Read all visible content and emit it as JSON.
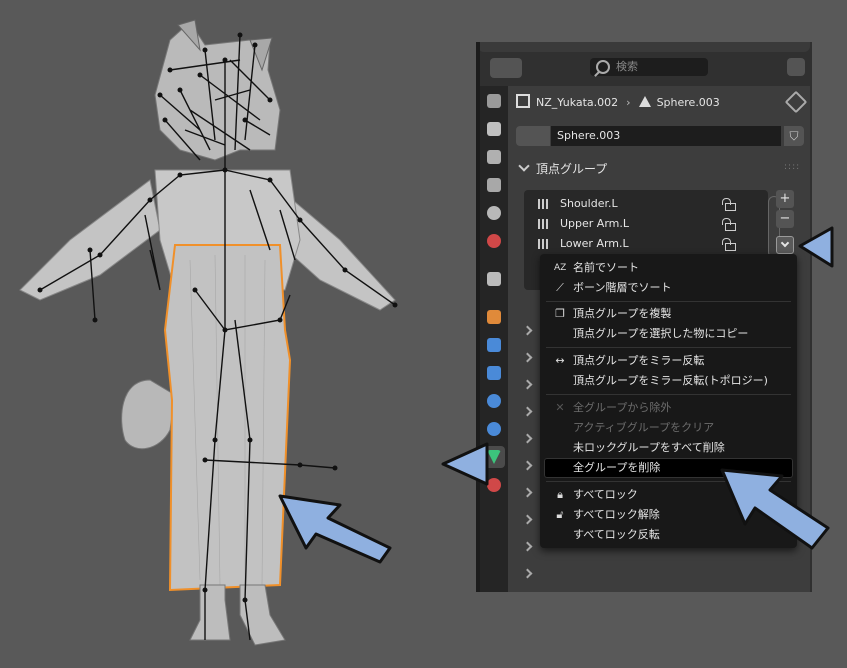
{
  "search": {
    "placeholder": "検索"
  },
  "breadcrumb": {
    "object": "NZ_Yukata.002",
    "mesh": "Sphere.003"
  },
  "datablock": {
    "name": "Sphere.003"
  },
  "section": {
    "title": "頂点グループ"
  },
  "vertex_groups": [
    {
      "name": "Shoulder.L"
    },
    {
      "name": "Upper Arm.L"
    },
    {
      "name": "Lower Arm.L"
    }
  ],
  "list_buttons": {
    "add": "+",
    "remove": "−"
  },
  "context_menu": {
    "items": [
      {
        "label": "名前でソート",
        "icon": "AZ",
        "disabled": false
      },
      {
        "label": "ボーン階層でソート",
        "icon": "bone-icon",
        "disabled": false
      },
      {
        "label": "頂点グループを複製",
        "icon": "copy-icon",
        "disabled": false
      },
      {
        "label": "頂点グループを選択した物にコピー",
        "icon": "",
        "disabled": false
      },
      {
        "label": "頂点グループをミラー反転",
        "icon": "mirror-icon",
        "disabled": false
      },
      {
        "label": "頂点グループをミラー反転(トポロジー)",
        "icon": "",
        "disabled": false
      },
      {
        "label": "全グループから除外",
        "icon": "x-icon",
        "disabled": true
      },
      {
        "label": "アクティブグループをクリア",
        "icon": "",
        "disabled": true
      },
      {
        "label": "未ロックグループをすべて削除",
        "icon": "",
        "disabled": false
      },
      {
        "label": "全グループを削除",
        "icon": "",
        "disabled": false,
        "highlighted": true
      },
      {
        "label": "すべてロック",
        "icon": "lock-icon",
        "disabled": false
      },
      {
        "label": "すべてロック解除",
        "icon": "unlock-icon",
        "disabled": false
      },
      {
        "label": "すべてロック反転",
        "icon": "",
        "disabled": false
      }
    ]
  },
  "colors": {
    "annotation_arrow": "#8fb0e0",
    "selection_outline": "#f0902a",
    "viewport_bg": "#595959",
    "panel_bg": "#3d3d3d"
  }
}
